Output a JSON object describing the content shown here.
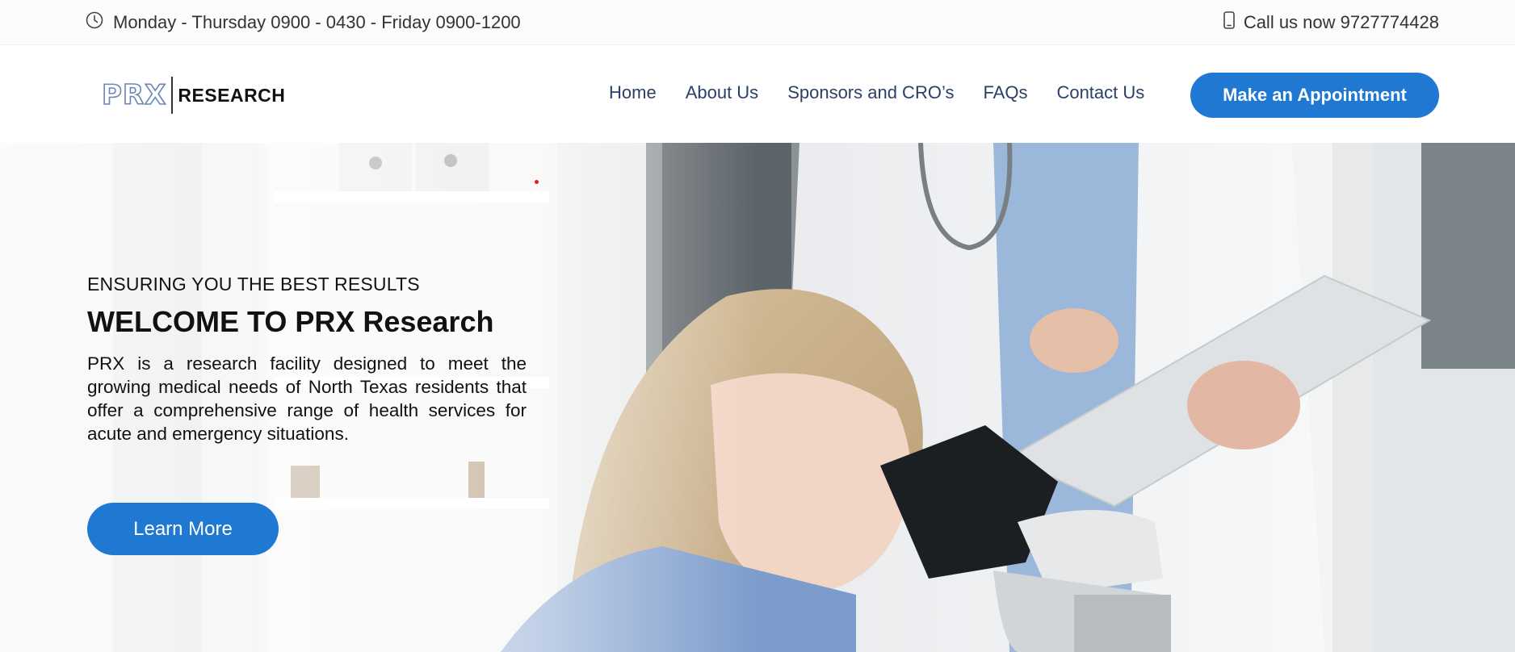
{
  "topbar": {
    "hours_text": "Monday - Thursday 0900 - 0430 - Friday 0900-1200",
    "phone_text": "Call us now 9727774428",
    "clock_icon": "clock-icon",
    "phone_icon": "mobile-phone-icon"
  },
  "header": {
    "logo": {
      "mark": "PRX",
      "word": "RESEARCH"
    },
    "nav": [
      {
        "label": "Home"
      },
      {
        "label": "About Us"
      },
      {
        "label": "Sponsors and CRO’s"
      },
      {
        "label": "FAQs"
      },
      {
        "label": "Contact Us"
      }
    ],
    "cta_label": "Make an Appointment"
  },
  "hero": {
    "eyebrow": "ENSURING YOU THE BEST RESULTS",
    "title": "WELCOME TO PRX Research",
    "description": "PRX is a research facility designed to meet the growing medical needs of North Texas residents that offer a comprehensive range of health services for acute and emergency situations.",
    "button_label": "Learn More"
  },
  "colors": {
    "accent": "#1f78d1",
    "nav_text": "#2b4066",
    "logo_outline": "#6a86b5"
  }
}
